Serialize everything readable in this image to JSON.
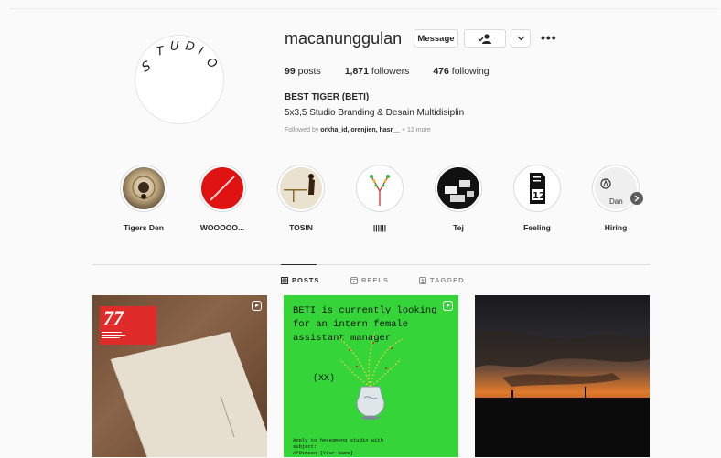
{
  "profile": {
    "username": "macanunggulan",
    "avatar_text": "STUDIO",
    "message_label": "Message",
    "follow_icon": "person-check-icon",
    "more_label": "•••",
    "stats": {
      "posts_count": "99",
      "posts_label": " posts",
      "followers_count": "1,871",
      "followers_label": " followers",
      "following_count": "476",
      "following_label": " following"
    },
    "full_name": "BEST TIGER (BETI)",
    "bio": "5x3,5 Studio Branding & Desain Multidisiplin",
    "followed_by_prefix": "Followed by ",
    "followed_by_names": "orkha_id, orenjien, hasr__",
    "followed_by_suffix": " + 12 more"
  },
  "highlights": [
    {
      "label": "Tigers Den"
    },
    {
      "label": "WOOOOO..."
    },
    {
      "label": "TOSIN"
    },
    {
      "label": "||||||"
    },
    {
      "label": "Tej"
    },
    {
      "label": "Feeling"
    },
    {
      "label": "Hiring",
      "inner_text": "Dan"
    }
  ],
  "tabs": [
    {
      "label": "POSTS",
      "icon": "grid-icon",
      "active": true
    },
    {
      "label": "REELS",
      "icon": "reels-icon",
      "active": false
    },
    {
      "label": "TAGGED",
      "icon": "tagged-icon",
      "active": false
    }
  ],
  "posts": [
    {
      "type": "reel",
      "logo_text": "77"
    },
    {
      "type": "reel",
      "headline": "BETI is currently looking\nfor an intern female\nassistant manager",
      "sub": "(XX)",
      "small": "Apply to hesegmeng studio with\nsubject:\nAPOtmeen-[Your Name]"
    },
    {
      "type": "photo"
    }
  ],
  "colors": {
    "green_post": "#35d53a",
    "red_highlight": "#e01313",
    "text_primary": "#262626",
    "text_secondary": "#8e8e8e"
  }
}
